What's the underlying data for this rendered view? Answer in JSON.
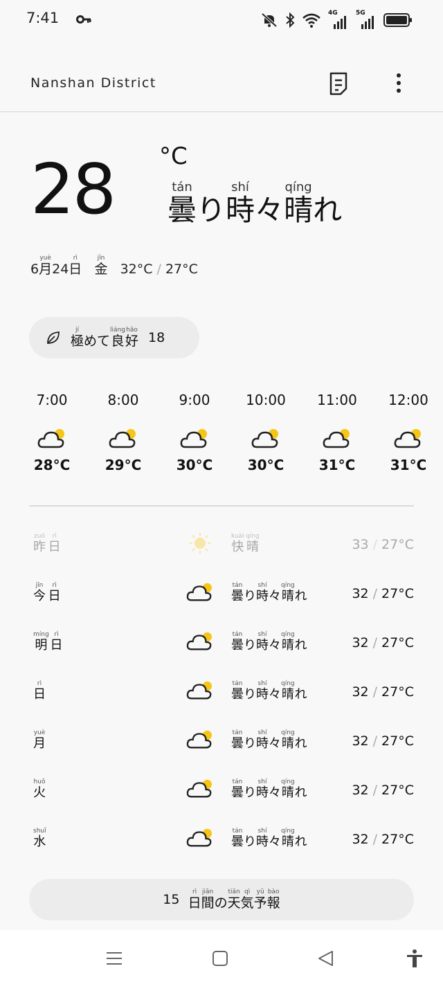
{
  "status_bar": {
    "time": "7:41",
    "icons": [
      "key-icon",
      "mute-icon",
      "bluetooth-icon",
      "wifi-icon",
      "signal-4g-icon",
      "signal-5g-icon",
      "battery-icon"
    ],
    "net1": "4G",
    "net2": "5G"
  },
  "header": {
    "location": "Nanshan District"
  },
  "current": {
    "temperature": "28",
    "unit": "°C",
    "condition": [
      {
        "text": "曇",
        "ruby": "tán"
      },
      {
        "text": "り",
        "ruby": ""
      },
      {
        "text": "時",
        "ruby": "shí"
      },
      {
        "text": "々",
        "ruby": ""
      },
      {
        "text": "晴",
        "ruby": "qíng"
      },
      {
        "text": "れ",
        "ruby": ""
      }
    ],
    "date": {
      "month": "6",
      "month_kanji": "月",
      "month_ruby": "yuè",
      "day": "24",
      "day_kanji": "日",
      "day_ruby": "rì",
      "weekday": "金",
      "weekday_ruby": "jīn",
      "high": "32°C",
      "low": "27°C"
    }
  },
  "aqi": {
    "label": [
      {
        "text": "極",
        "ruby": "jí"
      },
      {
        "text": "め",
        "ruby": ""
      },
      {
        "text": "て",
        "ruby": ""
      },
      {
        "text": "良",
        "ruby": "liáng"
      },
      {
        "text": "好",
        "ruby": "hǎo"
      }
    ],
    "value": "18"
  },
  "hourly": [
    {
      "time": "7:00",
      "temp": "28°C"
    },
    {
      "time": "8:00",
      "temp": "29°C"
    },
    {
      "time": "9:00",
      "temp": "30°C"
    },
    {
      "time": "10:00",
      "temp": "30°C"
    },
    {
      "time": "11:00",
      "temp": "31°C"
    },
    {
      "time": "12:00",
      "temp": "31°C"
    }
  ],
  "daily": [
    {
      "label": [
        {
          "text": "昨",
          "ruby": "zuó"
        },
        {
          "text": "日",
          "ruby": "rì"
        }
      ],
      "icon": "sun-icon",
      "condition": [
        {
          "text": "快",
          "ruby": "kuài"
        },
        {
          "text": "晴",
          "ruby": "qíng"
        }
      ],
      "high": "33",
      "low": "27°C"
    },
    {
      "label": [
        {
          "text": "今",
          "ruby": "jīn"
        },
        {
          "text": "日",
          "ruby": "rì"
        }
      ],
      "icon": "partly-cloudy-icon",
      "condition": [
        {
          "text": "曇",
          "ruby": "tán"
        },
        {
          "text": "り",
          "ruby": ""
        },
        {
          "text": "時",
          "ruby": "shí"
        },
        {
          "text": "々",
          "ruby": ""
        },
        {
          "text": "晴",
          "ruby": "qíng"
        },
        {
          "text": "れ",
          "ruby": ""
        }
      ],
      "high": "32",
      "low": "27°C"
    },
    {
      "label": [
        {
          "text": "明",
          "ruby": "míng"
        },
        {
          "text": "日",
          "ruby": "rì"
        }
      ],
      "icon": "partly-cloudy-icon",
      "condition": [
        {
          "text": "曇",
          "ruby": "tán"
        },
        {
          "text": "り",
          "ruby": ""
        },
        {
          "text": "時",
          "ruby": "shí"
        },
        {
          "text": "々",
          "ruby": ""
        },
        {
          "text": "晴",
          "ruby": "qíng"
        },
        {
          "text": "れ",
          "ruby": ""
        }
      ],
      "high": "32",
      "low": "27°C"
    },
    {
      "label": [
        {
          "text": "日",
          "ruby": "rì"
        }
      ],
      "icon": "partly-cloudy-icon",
      "condition": [
        {
          "text": "曇",
          "ruby": "tán"
        },
        {
          "text": "り",
          "ruby": ""
        },
        {
          "text": "時",
          "ruby": "shí"
        },
        {
          "text": "々",
          "ruby": ""
        },
        {
          "text": "晴",
          "ruby": "qíng"
        },
        {
          "text": "れ",
          "ruby": ""
        }
      ],
      "high": "32",
      "low": "27°C"
    },
    {
      "label": [
        {
          "text": "月",
          "ruby": "yuè"
        }
      ],
      "icon": "partly-cloudy-icon",
      "condition": [
        {
          "text": "曇",
          "ruby": "tán"
        },
        {
          "text": "り",
          "ruby": ""
        },
        {
          "text": "時",
          "ruby": "shí"
        },
        {
          "text": "々",
          "ruby": ""
        },
        {
          "text": "晴",
          "ruby": "qíng"
        },
        {
          "text": "れ",
          "ruby": ""
        }
      ],
      "high": "32",
      "low": "27°C"
    },
    {
      "label": [
        {
          "text": "火",
          "ruby": "huǒ"
        }
      ],
      "icon": "partly-cloudy-icon",
      "condition": [
        {
          "text": "曇",
          "ruby": "tán"
        },
        {
          "text": "り",
          "ruby": ""
        },
        {
          "text": "時",
          "ruby": "shí"
        },
        {
          "text": "々",
          "ruby": ""
        },
        {
          "text": "晴",
          "ruby": "qíng"
        },
        {
          "text": "れ",
          "ruby": ""
        }
      ],
      "high": "32",
      "low": "27°C"
    },
    {
      "label": [
        {
          "text": "水",
          "ruby": "shuǐ"
        }
      ],
      "icon": "partly-cloudy-icon",
      "condition": [
        {
          "text": "曇",
          "ruby": "tán"
        },
        {
          "text": "り",
          "ruby": ""
        },
        {
          "text": "時",
          "ruby": "shí"
        },
        {
          "text": "々",
          "ruby": ""
        },
        {
          "text": "晴",
          "ruby": "qíng"
        },
        {
          "text": "れ",
          "ruby": ""
        }
      ],
      "high": "32",
      "low": "27°C"
    }
  ],
  "forecast_button": {
    "prefix": "15",
    "label": [
      {
        "text": "日",
        "ruby": "rì"
      },
      {
        "text": "間",
        "ruby": "jiān"
      },
      {
        "text": "の",
        "ruby": ""
      },
      {
        "text": "天",
        "ruby": "tiān"
      },
      {
        "text": "気",
        "ruby": "qì"
      },
      {
        "text": "予",
        "ruby": "yǔ"
      },
      {
        "text": "報",
        "ruby": "bào"
      }
    ]
  },
  "nav_bar": {
    "icons": [
      "recents-icon",
      "home-icon",
      "back-icon",
      "accessibility-icon"
    ]
  },
  "colors": {
    "sun": "#f5c518",
    "cloud_stroke": "#222222",
    "background": "#f8f8f8",
    "pill": "#ececec"
  }
}
